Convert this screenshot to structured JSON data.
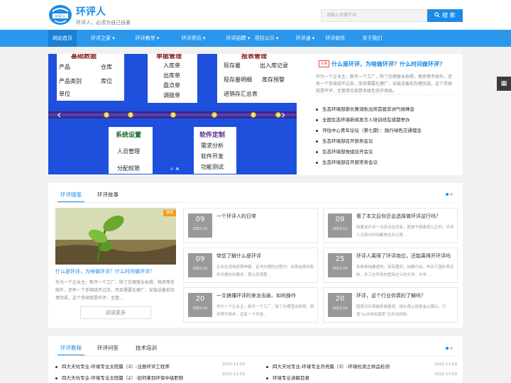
{
  "header": {
    "logo_text": "环评人",
    "site_name": "环评人",
    "slogan": "环评人，必须为自己自豪",
    "search_placeholder": "请输入关键字词",
    "search_button": "搜 索"
  },
  "nav": {
    "items": [
      {
        "label": "网站首页"
      },
      {
        "label": "环评之家 ▾"
      },
      {
        "label": "环评教学 ▾"
      },
      {
        "label": "环评资讯 ▾"
      },
      {
        "label": "环评招聘 ▾"
      },
      {
        "label": "项目公示 ▾"
      },
      {
        "label": "环评通 ▾"
      },
      {
        "label": "环评软件"
      },
      {
        "label": "关于我们"
      }
    ]
  },
  "side_tool_icon": "grid-icon",
  "slider": {
    "boxes": [
      {
        "title": "基础数据",
        "lines": [
          "产品",
          "仓库",
          "产品类别",
          "库位",
          "单位"
        ]
      },
      {
        "title": "单据管理",
        "lines": [
          "入库单",
          "出库单",
          "盘点单",
          "调拨单"
        ]
      },
      {
        "title": "报表管理",
        "lines": [
          "现存量",
          "出入库记录",
          "现存量明细",
          "库存预警",
          "进销存汇总表"
        ]
      },
      {
        "title": "系统设置",
        "lines": [
          "人员管理",
          "分配权限"
        ]
      },
      {
        "title": "软件定制",
        "lines": [
          "需求分析",
          "软件开发",
          "功能测试"
        ]
      }
    ]
  },
  "headline": {
    "tag": "头条",
    "title": "什么是环评，为啥做环评？什么时间做环评？",
    "desc": "作为一个企业主，新开一个工厂，除了办理营业执照，税务等手续外，还有一个手续绕不过去，而且需要在建厂、安装设备前办理完成，这个手续就是环评，主管单位就是各级生态环境局。"
  },
  "news": [
    "生态环境部部长黄润秋出席首届非洲气候峰会",
    "全国生态环境新闻发言人培训班在成都举办",
    "评估中心青年论坛（第七期）：践行绿色交通理念",
    "生态环境部召开部务会议",
    "生态环境部党组召开会议",
    "生态环境部召开部常务会议"
  ],
  "section1": {
    "tabs": [
      "环评随笔",
      "环评故事"
    ],
    "featured": {
      "badge": "推荐",
      "title": "什么是环评，为啥做环评？什么时间做环评？",
      "desc": "作为一个企业主，新开一个工厂，除了办理营业执照，税务等手续外，还有一个手续绕不过去，而且需要在建厂、安装设备前办理完成，这个手续就是环评，主管..."
    },
    "more": "阅读更多",
    "articles": [
      {
        "day": "09",
        "ym": "2022-11",
        "title": "一个环评人的日常",
        "desc": ""
      },
      {
        "day": "09",
        "ym": "2022-11",
        "title": "看了本文后你还会选择做环评这行吗？",
        "desc": "如果说环评一点优点也没有，那是不够客观公正的。环评人大部分时间都是在办公室..."
      },
      {
        "day": "09",
        "ym": "2022-11",
        "title": "带您了解什么是环评",
        "desc": "企业在咨询资质申报、证书办理的过程中，经常会提到有环评报告的要求，那么您清楚..."
      },
      {
        "day": "25",
        "ym": "2022-10",
        "title": "环评人离得了环评岗位，还能离得开环评吗",
        "desc": "本故事纯属虚构，如有雷同，纯属巧合。毕业于国外某名校，孙工在异省的国际庄上的大学，大学..."
      },
      {
        "day": "20",
        "ym": "2022-10",
        "title": "一文搞懂环评的来龙去脉、如何操作",
        "desc": "作为一个企业主，新开一个工厂，除了办理营业执照，税务等手续外，还有一个手续..."
      },
      {
        "day": "20",
        "ym": "2022-10",
        "title": "环评，这个行业你真的了解吗？",
        "desc": "国家对环保越来越重视，绿水青山就是金山银山，打造\"山水林田湖草\"生命共同体。"
      }
    ]
  },
  "section2": {
    "tabs": [
      "环评教程",
      "环评问答",
      "技术培训"
    ],
    "items": [
      {
        "title": "四大天坑专业-环境专业太阳篇（3）-注册环评工程师",
        "date": "2022-11-03"
      },
      {
        "title": "四大天坑专业-环境专业月亮篇（3）-环境检测之样品检测",
        "date": "2022-11-03"
      },
      {
        "title": "四大天坑专业-环境专业太阳篇（2）-如何拿到环保中级职称",
        "date": "2022-11-03"
      },
      {
        "title": "环境专业讲解目录",
        "date": "2022-11-03"
      }
    ]
  },
  "colors": {
    "brand": "#1d8be6",
    "nav": "#2b97ec",
    "accent": "#f59c1b"
  }
}
